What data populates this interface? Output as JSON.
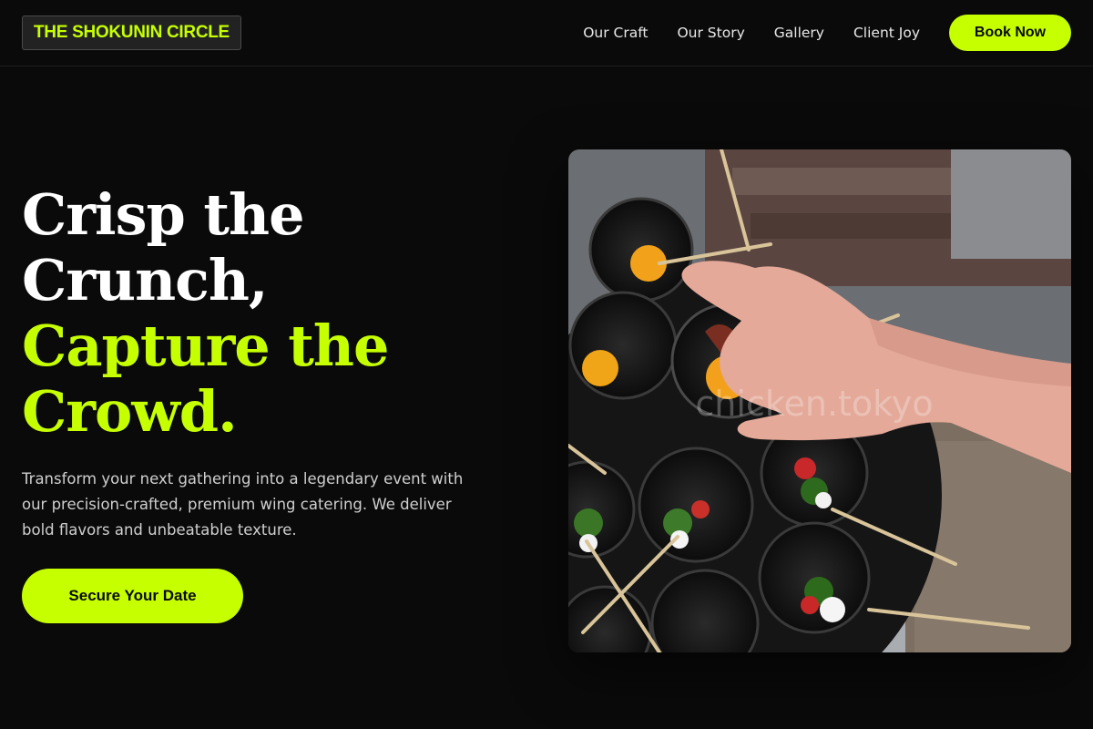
{
  "header": {
    "logo": "THE SHOKUNIN CIRCLE",
    "nav": [
      "Our Craft",
      "Our Story",
      "Gallery",
      "Client Joy"
    ],
    "book_label": "Book Now"
  },
  "hero": {
    "headline_white_1": "Crisp the",
    "headline_white_2": "Crunch,",
    "headline_accent_1": "Capture the",
    "headline_accent_2": "Crowd.",
    "description": "Transform your next gathering into a legendary event with our precision-crafted, premium wing catering. We deliver bold flavors and unbeatable texture.",
    "cta_label": "Secure Your Date"
  },
  "photo": {
    "watermark": "chicken.tokyo"
  },
  "colors": {
    "accent": "#c6ff00",
    "background": "#0a0a0a"
  }
}
